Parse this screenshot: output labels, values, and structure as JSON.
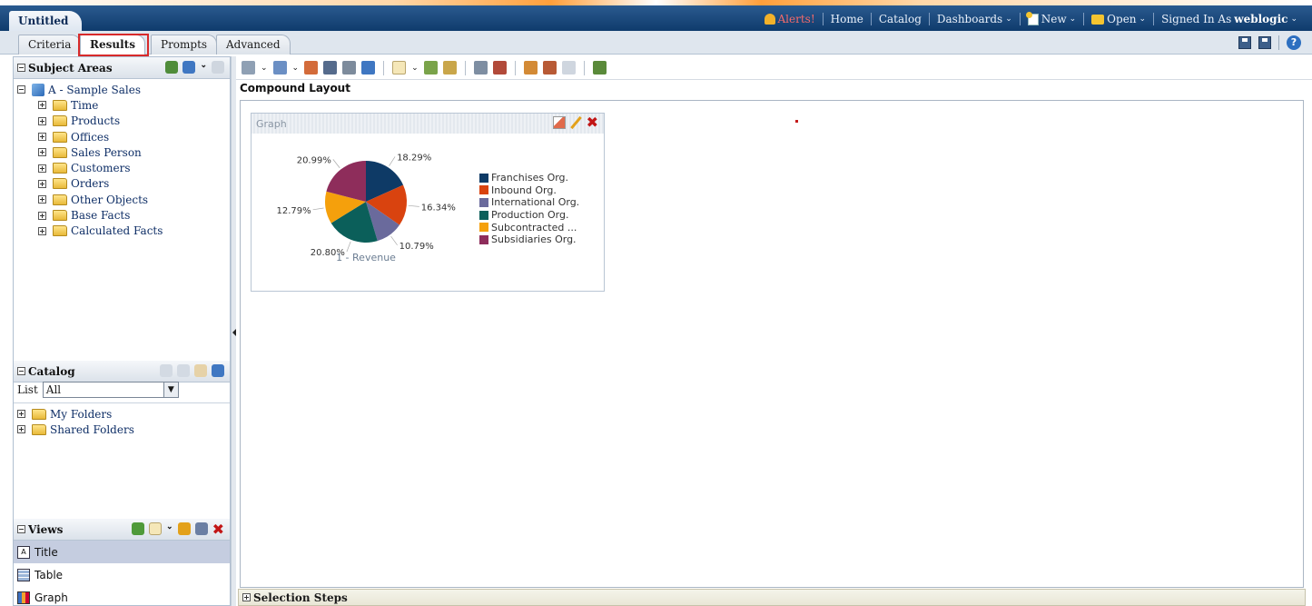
{
  "app": {
    "doc_tab": "Untitled",
    "nav": {
      "alerts": "Alerts!",
      "home": "Home",
      "catalog": "Catalog",
      "dashboards": "Dashboards",
      "new": "New",
      "open": "Open",
      "signed_in_prefix": "Signed In As",
      "user": "weblogic"
    }
  },
  "tabs": [
    {
      "label": "Criteria"
    },
    {
      "label": "Results",
      "active": true
    },
    {
      "label": "Prompts"
    },
    {
      "label": "Advanced"
    }
  ],
  "subject_areas": {
    "title": "Subject Areas",
    "root": "A - Sample Sales",
    "folders": [
      "Time",
      "Products",
      "Offices",
      "Sales Person",
      "Customers",
      "Orders",
      "Other Objects",
      "Base Facts",
      "Calculated Facts"
    ]
  },
  "catalog": {
    "title": "Catalog",
    "list_label": "List",
    "list_value": "All",
    "folders": [
      "My Folders",
      "Shared Folders"
    ]
  },
  "views": {
    "title": "Views",
    "items": [
      {
        "label": "Title",
        "icon": "title-view-icon",
        "selected": true
      },
      {
        "label": "Table",
        "icon": "table-view-icon"
      },
      {
        "label": "Graph",
        "icon": "graph-view-icon"
      }
    ]
  },
  "main": {
    "section_title": "Compound Layout",
    "selection_steps": "Selection Steps"
  },
  "graph": {
    "header": "Graph",
    "chart_data": {
      "type": "pie",
      "xlabel": "1 - Revenue",
      "categories": [
        "Franchises Org.",
        "Inbound Org.",
        "International Org.",
        "Production Org.",
        "Subcontracted ...",
        "Subsidiaries Org."
      ],
      "values": [
        18.29,
        16.34,
        10.79,
        20.8,
        12.79,
        20.99
      ],
      "labels": [
        "18.29%",
        "16.34%",
        "10.79%",
        "20.80%",
        "12.79%",
        "20.99%"
      ],
      "colors": [
        "#0e3a66",
        "#d9430f",
        "#6a6a9c",
        "#0b5f5a",
        "#f5a00c",
        "#8e2d5b"
      ]
    }
  },
  "colors": {
    "header_bg": "#0f3b6c",
    "highlight_red": "#d82a2a",
    "selected_row": "#c5cde0"
  }
}
